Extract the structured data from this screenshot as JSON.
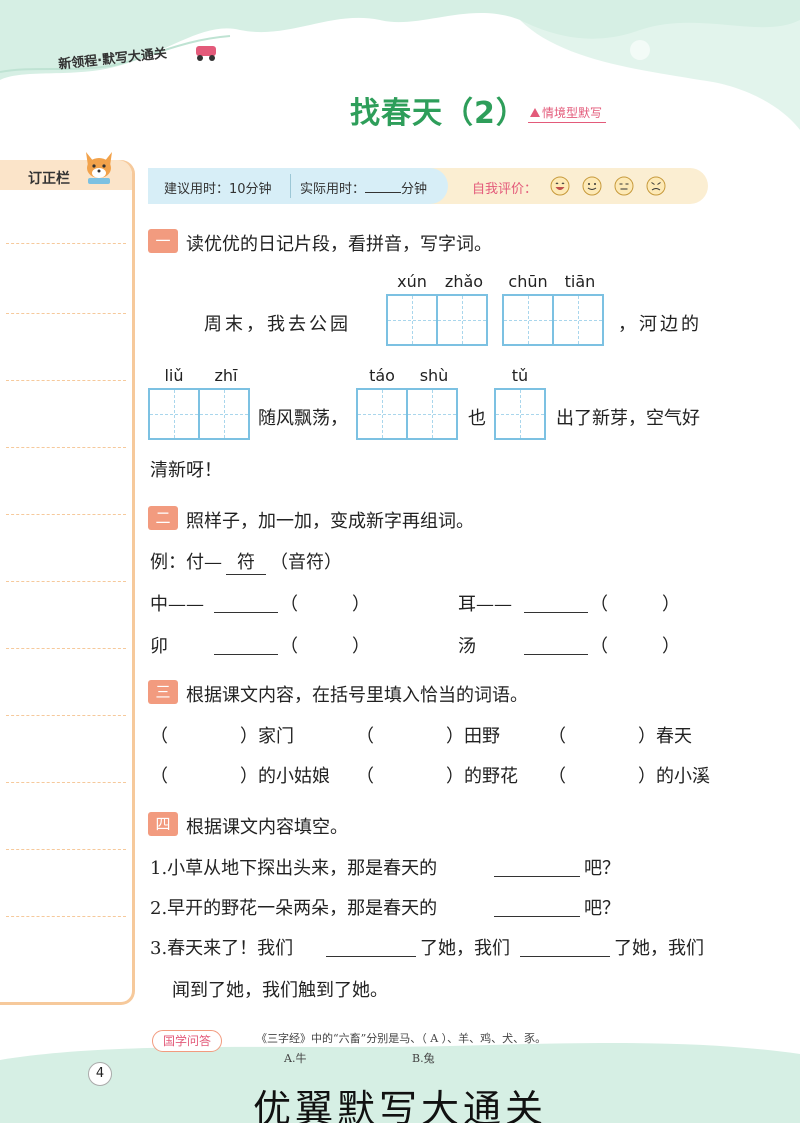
{
  "header": {
    "series_title": "新领程·默写大通关",
    "page_title": "找春天（2）",
    "title_tag": "情境型默写"
  },
  "correction": {
    "label": "订正栏"
  },
  "time_bar": {
    "suggested": "建议用时：10分钟",
    "actual_label": "实际用时：",
    "actual_unit": "分钟",
    "self_eval": "自我评价："
  },
  "section1": {
    "num": "一",
    "title": "读优优的日记片段，看拼音，写字词。",
    "line1_text": "周末，我去公园",
    "line1_end": "，河边的",
    "pinyin": {
      "xun": "xún",
      "zhao": "zhǎo",
      "chun": "chūn",
      "tian": "tiān",
      "liu": "liǔ",
      "zhi": "zhī",
      "tao": "táo",
      "shu": "shù",
      "tu": "tǔ"
    },
    "line2_a": "随风飘荡，",
    "line2_b": "也",
    "line2_c": "出了新芽，空气好",
    "line3": "清新呀！"
  },
  "section2": {
    "num": "二",
    "title": "照样子，加一加，变成新字再组词。",
    "example_prefix": "例：付—",
    "example_answer": "符",
    "example_word": "（音符）",
    "items": [
      {
        "char": "中——",
        "paren": "（　　　）"
      },
      {
        "char": "耳——",
        "paren": "（　　　）"
      },
      {
        "char": "卯",
        "paren": "（　　　）"
      },
      {
        "char": "汤",
        "paren": "（　　　）"
      }
    ]
  },
  "section3": {
    "num": "三",
    "title": "根据课文内容，在括号里填入恰当的词语。",
    "row1": [
      "（　　　　）家门",
      "（　　　　）田野",
      "（　　　　）春天"
    ],
    "row2": [
      "（　　　　）的小姑娘",
      "（　　　　）的野花",
      "（　　　　）的小溪"
    ]
  },
  "section4": {
    "num": "四",
    "title": "根据课文内容填空。",
    "q1_a": "1.小草从地下探出头来，那是春天的",
    "q1_b": "吧？",
    "q2_a": "2.早开的野花一朵两朵，那是春天的",
    "q2_b": "吧？",
    "q3_a": "3.春天来了！我们",
    "q3_b": "了她，我们",
    "q3_c": "了她，我们",
    "q3_d": "闻到了她，我们触到了她。"
  },
  "footer": {
    "guoxue": "国学问答",
    "question": "《三字经》中的“六畜”分别是马、（ A ）、羊、鸡、犬、豕。",
    "opt_a": "A.牛",
    "opt_b": "B.兔",
    "page_number": "4",
    "watermark": "优翼默写大通关"
  },
  "colors": {
    "title_green": "#2e9e5a",
    "box_blue": "#7cc1e2",
    "section_orange": "#f29b7f",
    "pink": "#e35a7a",
    "mint": "#d6efe4"
  }
}
